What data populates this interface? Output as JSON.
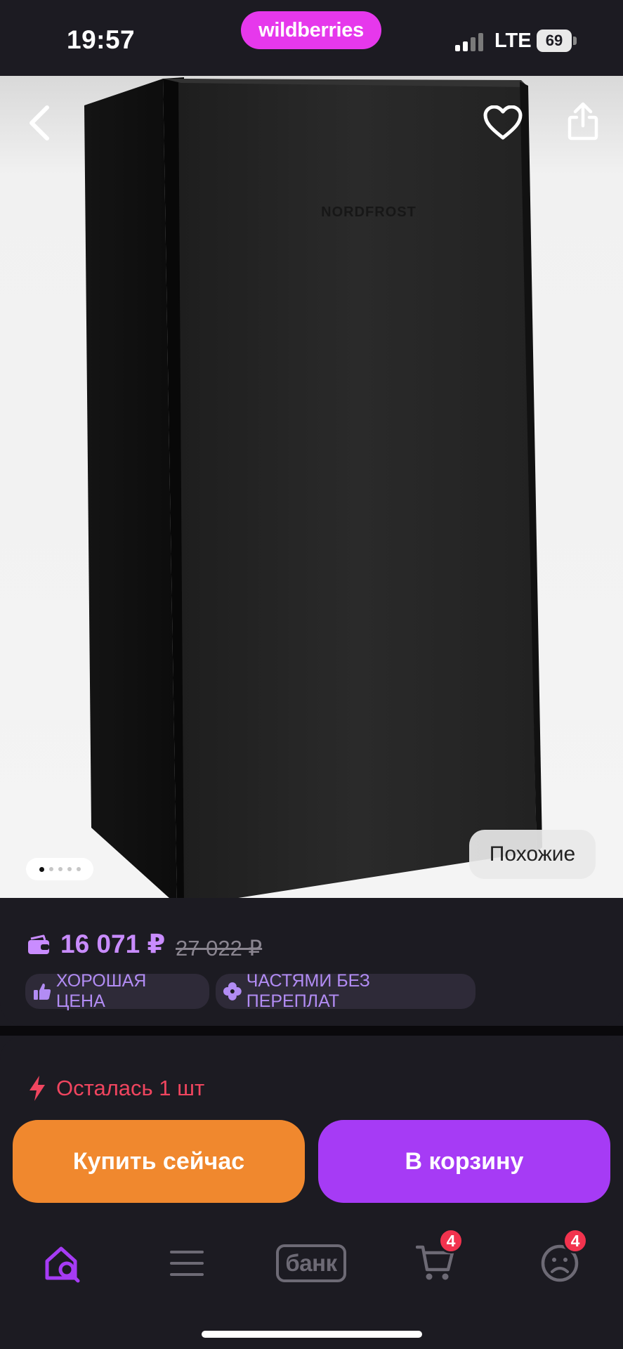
{
  "status_bar": {
    "time": "19:57",
    "brand": "wildberries",
    "network": "LTE",
    "battery": "69"
  },
  "product": {
    "image_icon_names": [
      "fridge-image"
    ],
    "logo_text": "NORDFROST",
    "gallery_pages": 5,
    "gallery_active_page": 1,
    "similar_label": "Похожие"
  },
  "price_card": {
    "price": "16 071 ₽",
    "old_price": "27 022 ₽",
    "badges": [
      {
        "label": "ХОРОШАЯ ЦЕНА",
        "icon": "thumbs-up-icon"
      },
      {
        "label": "ЧАСТЯМИ БЕЗ ПЕРЕПЛАТ",
        "icon": "clover-icon"
      }
    ]
  },
  "purchase": {
    "stock_text": "Осталась 1 шт",
    "buy_now_label": "Купить сейчас",
    "to_cart_label": "В корзину"
  },
  "tab_bar": {
    "bank_label": "банк",
    "cart_count": "4",
    "profile_count": "4"
  },
  "colors": {
    "background": "#1c1b22",
    "brand": "#e638ec",
    "accent_purple": "#a63bf5",
    "buy_orange": "#f0882e",
    "price_purple": "#c98cff",
    "alert_red": "#f0455f"
  }
}
